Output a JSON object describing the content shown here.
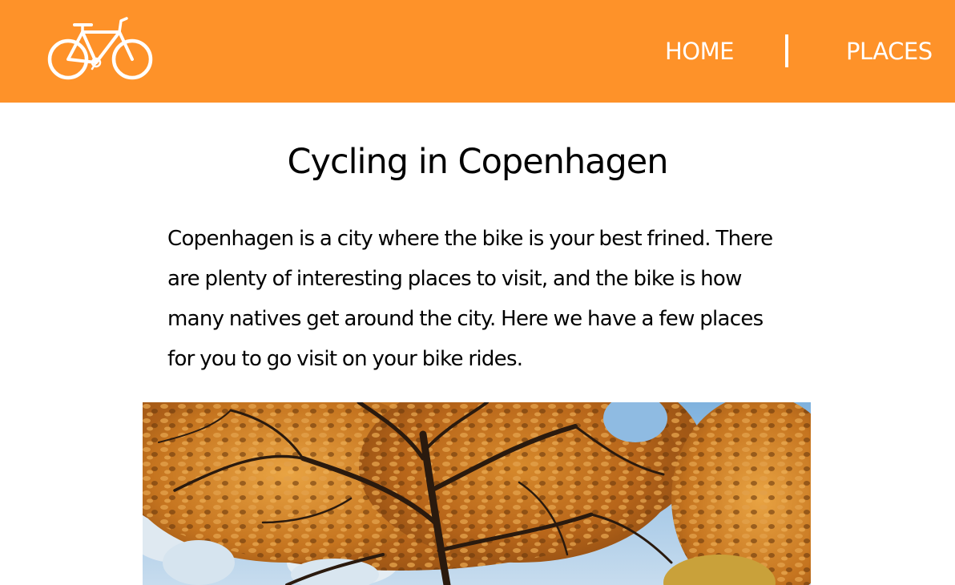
{
  "header": {
    "logo": "bicycle-icon",
    "background_color": "#fe9229",
    "nav": [
      {
        "label": "HOME"
      },
      {
        "label": "PLACES"
      }
    ]
  },
  "main": {
    "title": "Cycling in Copenhagen",
    "intro": "Copenhagen is a city where the bike is your best frined. There are plenty of interesting places to visit, and the bike is how many natives get around the city. Here we have a few places for you to go visit on your bike rides.",
    "hero_image": "autumn-trees-photo"
  }
}
